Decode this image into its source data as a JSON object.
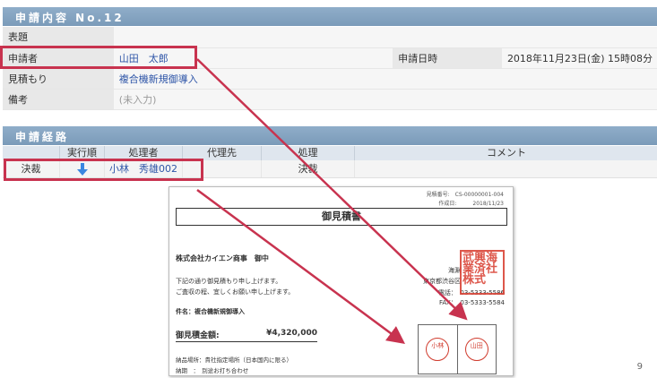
{
  "application_section": {
    "header": "申請内容 No.12",
    "rows": [
      {
        "label": "表題",
        "value": ""
      },
      {
        "label": "申請者",
        "value": "山田　太郎",
        "extra_label": "申請日時",
        "extra_value": "2018年11月23日(金) 15時08分"
      },
      {
        "label": "見積もり",
        "value": "複合機新規御導入"
      },
      {
        "label": "備考",
        "value": "(未入力)"
      }
    ]
  },
  "route_section": {
    "header": "申請経路",
    "columns": [
      "",
      "実行順",
      "処理者",
      "代理先",
      "処理",
      "コメント"
    ],
    "row": {
      "type": "決裁",
      "order_icon": "down-arrow-icon",
      "processor": "小林　秀雄002",
      "proxy": "",
      "action": "決裁",
      "comment": ""
    }
  },
  "document": {
    "meta_no": "見積番号:　CS-00000001-004",
    "meta_date": "作成日:　　　2018/11/23",
    "title": "御見積書",
    "recipient": "株式会社カイエン商事　御中",
    "body_line1": "下記の通り御見積もり申し上げます。",
    "body_line2": "ご査収の程、宜しくお願い申し上げます。",
    "subject": "件名：複合機新規御導入",
    "total_label": "御見積金額:",
    "total_value": "¥4,320,000",
    "delivery": "納品場所：貴社指定場所（日本国内に限る）",
    "deadline": "納期　：　別途お打ち合わせ",
    "company_city": "海淵",
    "company_address": "東京都渋谷区",
    "company_tel": "電話：　03-5333-5586",
    "company_fax": "FAX：　03-5333-5584",
    "company_seal_text": "武興海業済社株式",
    "stamp_left": "小林",
    "stamp_right": "山田"
  },
  "page_number": "9",
  "colors": {
    "accent": "#c8334f",
    "header": "#7b9bb9",
    "link": "#2f56a8",
    "stamp": "#d03a2c",
    "arrow_icon": "#3a86e0"
  }
}
